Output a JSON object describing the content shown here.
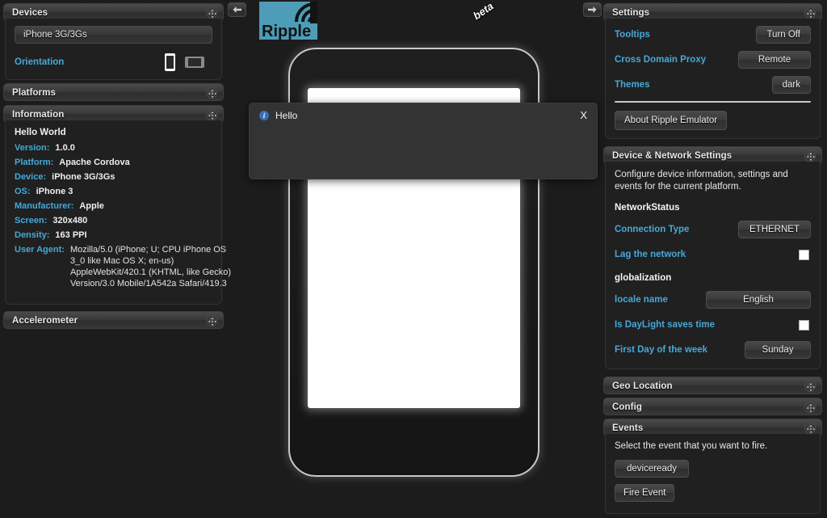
{
  "app": {
    "logo_text": "Ripple",
    "beta_label": "beta",
    "logo_color": "#4d9cb8"
  },
  "nav": {
    "collapse_left_icon": "arrow-left-icon",
    "collapse_right_icon": "arrow-right-icon"
  },
  "left": {
    "devices": {
      "title": "Devices",
      "selected_device": "iPhone 3G/3Gs",
      "orientation_label": "Orientation",
      "portrait_icon": "device-portrait-icon",
      "landscape_icon": "device-landscape-icon"
    },
    "platforms": {
      "title": "Platforms"
    },
    "information": {
      "title": "Information",
      "app_name": "Hello World",
      "rows": [
        {
          "key": "Version:",
          "value": "1.0.0"
        },
        {
          "key": "Platform:",
          "value": "Apache Cordova"
        },
        {
          "key": "Device:",
          "value": "iPhone 3G/3Gs"
        },
        {
          "key": "OS:",
          "value": "iPhone 3"
        },
        {
          "key": "Manufacturer:",
          "value": "Apple"
        },
        {
          "key": "Screen:",
          "value": "320x480"
        },
        {
          "key": "Density:",
          "value": "163 PPI"
        }
      ],
      "user_agent_key": "User Agent:",
      "user_agent_lines": [
        "Mozilla/5.0 (iPhone; U; CPU iPhone OS",
        "3_0 like Mac OS X; en-us)",
        "AppleWebKit/420.1 (KHTML, like Gecko)",
        "Version/3.0 Mobile/1A542a Safari/419.3"
      ]
    },
    "accelerometer": {
      "title": "Accelerometer"
    }
  },
  "dialog": {
    "icon": "info-icon",
    "title": "Hello",
    "close_label": "X",
    "body": ""
  },
  "right": {
    "settings": {
      "title": "Settings",
      "rows": [
        {
          "label": "Tooltips",
          "value": "Turn Off"
        },
        {
          "label": "Cross Domain Proxy",
          "value": "Remote"
        },
        {
          "label": "Themes",
          "value": "dark"
        }
      ],
      "about_label": "About Ripple Emulator"
    },
    "device_network": {
      "title": "Device & Network Settings",
      "description": "Configure device information, settings and events for the current platform.",
      "network_status_title": "NetworkStatus",
      "connection_type_label": "Connection Type",
      "connection_type_value": "ETHERNET",
      "lag_label": "Lag the network",
      "lag_checked": false,
      "globalization_title": "globalization",
      "locale_label": "locale name",
      "locale_value": "English",
      "daylight_label": "Is DayLight saves time",
      "daylight_checked": false,
      "first_day_label": "First Day of the week",
      "first_day_value": "Sunday"
    },
    "geo_location": {
      "title": "Geo Location"
    },
    "config": {
      "title": "Config"
    },
    "events": {
      "title": "Events",
      "description": "Select the event that you want to fire.",
      "selected_event": "deviceready",
      "fire_label": "Fire Event"
    }
  }
}
